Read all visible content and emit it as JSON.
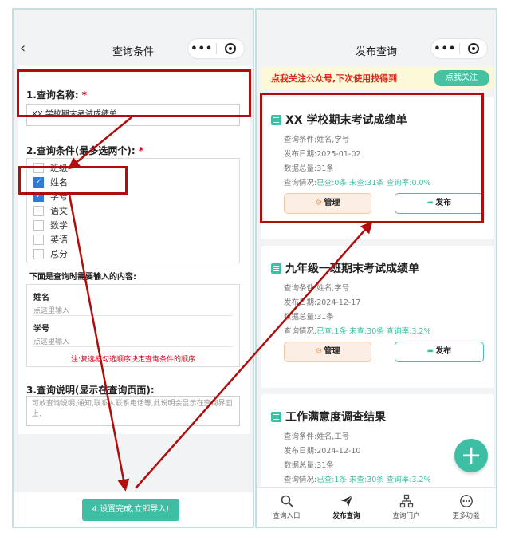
{
  "left": {
    "nav_title": "查询条件",
    "section1_title": "1.查询名称:",
    "required_mark": "*",
    "name_value": "XX 学校期末考试成绩单",
    "section2_title": "2.查询条件(最多选两个):",
    "options": [
      {
        "label": "班级",
        "checked": false
      },
      {
        "label": "姓名",
        "checked": true
      },
      {
        "label": "学号",
        "checked": true
      },
      {
        "label": "语文",
        "checked": false
      },
      {
        "label": "数学",
        "checked": false
      },
      {
        "label": "英语",
        "checked": false
      },
      {
        "label": "总分",
        "checked": false
      }
    ],
    "input_hint": "下面是查询时需要输入的内容:",
    "fields": [
      {
        "label": "姓名",
        "placeholder": "点这里输入"
      },
      {
        "label": "学号",
        "placeholder": "点这里输入"
      }
    ],
    "field_note": "注:复选框勾选顺序决定查询条件的顺序",
    "section3_title": "3.查询说明(显示在查询页面):",
    "desc_placeholder": "可放查询说明,通知,联系人联系电话等,此说明会显示在查询界面上.",
    "import_button": "4.设置完成,立即导入!"
  },
  "right": {
    "nav_title": "发布查询",
    "banner_text": "点我关注公众号,下次使用找得到",
    "follow_button": "点我关注",
    "cards": [
      {
        "title": "XX 学校期末考试成绩单",
        "conditions": "查询条件:姓名,学号",
        "date": "发布日期:2025-01-02",
        "total": "数据总量:31条",
        "status_label": "查询情况:",
        "status": "已查:0条 未查:31条 查询率:0.0%"
      },
      {
        "title": "九年级一班期末考试成绩单",
        "conditions": "查询条件:姓名,学号",
        "date": "发布日期:2024-12-17",
        "total": "数据总量:31条",
        "status_label": "查询情况:",
        "status": "已查:1条 未查:30条 查询率:3.2%"
      },
      {
        "title": "工作满意度调查结果",
        "conditions": "查询条件:姓名,工号",
        "date": "发布日期:2024-12-10",
        "total": "数据总量:31条",
        "status_label": "查询情况:",
        "status": "已查:1条 未查:30条 查询率:3.2%"
      }
    ],
    "manage_button": "管理",
    "publish_button": "发布",
    "fab_symbol": "+",
    "tabs": [
      {
        "label": "查询入口",
        "icon": "search-icon",
        "active": false
      },
      {
        "label": "发布查询",
        "icon": "paper-plane-icon",
        "active": true
      },
      {
        "label": "查询门户",
        "icon": "org-chart-icon",
        "active": false
      },
      {
        "label": "更多功能",
        "icon": "more-icon",
        "active": false
      }
    ]
  },
  "colors": {
    "accent": "#3ebfa3",
    "annotation_red": "#b00d0d",
    "required_red": "#d9001b",
    "checkbox_blue": "#2f7bd6",
    "banner_bg": "#fdf8d8"
  }
}
